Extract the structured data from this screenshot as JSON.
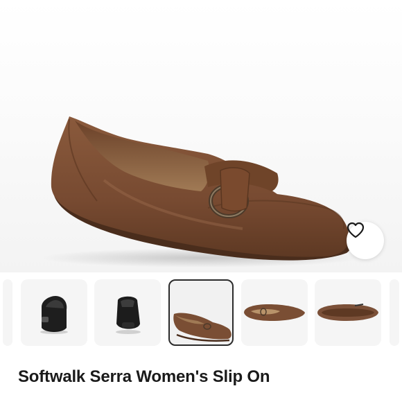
{
  "product": {
    "title": "Softwalk Serra Women's Slip On"
  },
  "gallery": {
    "selected_index": 2,
    "thumbnails": [
      {
        "view": "front"
      },
      {
        "view": "back"
      },
      {
        "view": "side-angle"
      },
      {
        "view": "top"
      },
      {
        "view": "sole"
      }
    ]
  },
  "actions": {
    "favorite_icon": "heart-outline-icon"
  },
  "colors": {
    "leather": "#7a4e34",
    "background": "#ffffff",
    "thumb_bg": "#f5f5f5",
    "selected_border": "#2b2b2b"
  }
}
